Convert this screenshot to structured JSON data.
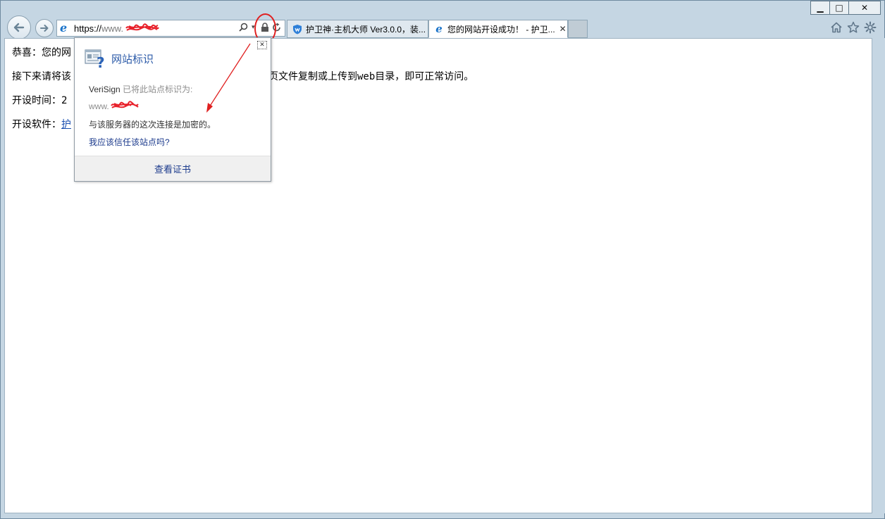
{
  "window": {
    "caption": {
      "minimize": "▁",
      "maximize": "□",
      "close": "✕"
    }
  },
  "address_bar": {
    "scheme": "https://",
    "host_visible": "www.",
    "icons": [
      "search-icon",
      "dropdown-icon",
      "lock-icon",
      "refresh-icon"
    ]
  },
  "tabs": [
    {
      "label": "护卫神·主机大师 Ver3.0.0，装...",
      "icon": "shield-icon",
      "active": false
    },
    {
      "label": "您的网站开设成功！ - 护卫...",
      "icon": "ie-icon",
      "active": true,
      "close": "✕"
    }
  ],
  "toolbar": {
    "icons": [
      "home-icon",
      "favorites-star-icon",
      "settings-gear-icon"
    ]
  },
  "page": {
    "line1": "恭喜：您的网",
    "line2_prefix": "接下来请将该",
    "line2_suffix": "的网页文件复制或上传到web目录，即可正常访问。",
    "line3": "开设时间：2",
    "line4_prefix": "开设软件：",
    "line4_link": "护"
  },
  "site_identity_popup": {
    "title": "网站标识",
    "issuer": "VeriSign",
    "issuer_text": "已将此站点标识为:",
    "host_visible": "www.",
    "encrypted_text": "与该服务器的这次连接是加密的。",
    "trust_link": "我应该信任该站点吗?",
    "view_certificate": "查看证书",
    "close": "✕"
  },
  "colors": {
    "frame": "#c5d6e3",
    "annotation_red": "#e02020",
    "link_blue": "#1b3a8c",
    "title_blue": "#2b5aa8"
  }
}
